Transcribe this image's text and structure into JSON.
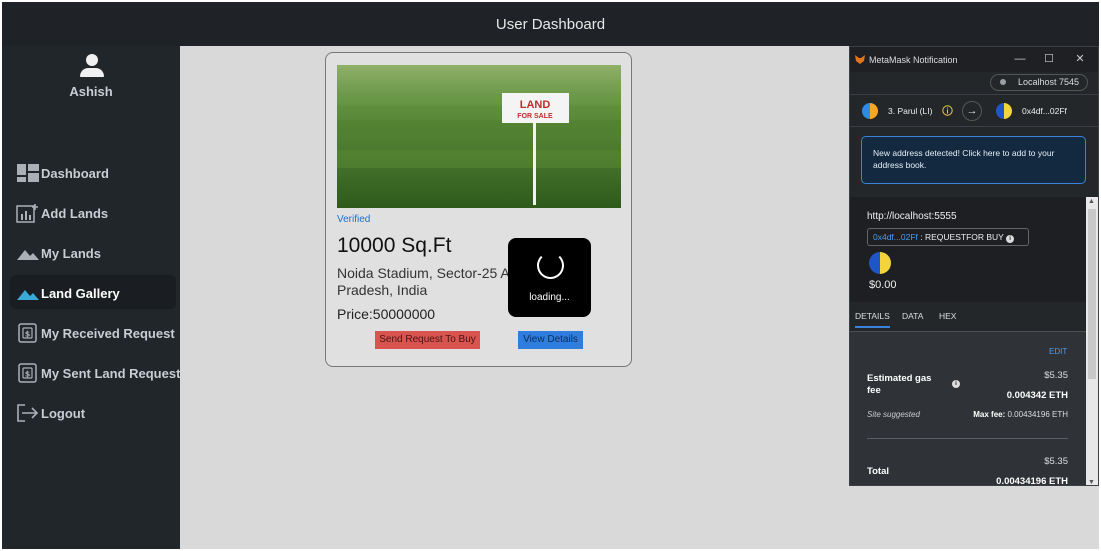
{
  "header": {
    "title": "User Dashboard"
  },
  "user": {
    "name": "Ashish"
  },
  "sidebar": {
    "items": [
      {
        "label": "Dashboard",
        "icon": "dashboard-icon"
      },
      {
        "label": "Add Lands",
        "icon": "add-chart-icon"
      },
      {
        "label": "My Lands",
        "icon": "landscape-icon"
      },
      {
        "label": "Land Gallery",
        "icon": "landscape-icon",
        "active": true
      },
      {
        "label": "My Received Request",
        "icon": "request-doc-icon"
      },
      {
        "label": "My Sent Land Request",
        "icon": "request-doc-icon"
      },
      {
        "label": "Logout",
        "icon": "logout-icon"
      }
    ]
  },
  "card": {
    "image_sign_line1": "LAND",
    "image_sign_line2": "FOR SALE",
    "status": "Verified",
    "area": "10000 Sq.Ft",
    "address": "Noida Stadium, Sector-25 A Pradesh, India",
    "price": "Price:50000000",
    "buy_label": "Send Request To Buy",
    "view_label": "View Details"
  },
  "loader": {
    "text": "loading..."
  },
  "metamask": {
    "window_title": "MetaMask Notification",
    "network": "Localhost 7545",
    "from_account": "3. Parul (LI)",
    "to_account": "0x4df...02Ff",
    "notice": "New address detected! Click here to add to your address book.",
    "origin": "http://localhost:5555",
    "method_address": "0x4df...02Ff",
    "method_name": " : REQUESTFOR BUY",
    "value": "$0.00",
    "tabs": [
      "DETAILS",
      "DATA",
      "HEX"
    ],
    "edit_label": "EDIT",
    "gas_label": "Estimated gas fee",
    "gas_usd": "$5.35",
    "gas_eth": "0.004342 ETH",
    "site_suggested": "Site suggested",
    "max_fee_label": "Max fee:",
    "max_fee_value": "0.00434196 ETH",
    "total_label": "Total",
    "total_usd": "$5.35",
    "total_eth": "0.00434196 ETH"
  },
  "colors": {
    "sidebar_bg": "#21262b",
    "topbar_bg": "#1f2227",
    "buy_button": "#d9534f",
    "view_button": "#2f7dde",
    "verified": "#1a6fd4",
    "metamask_accent": "#3a83d6"
  }
}
